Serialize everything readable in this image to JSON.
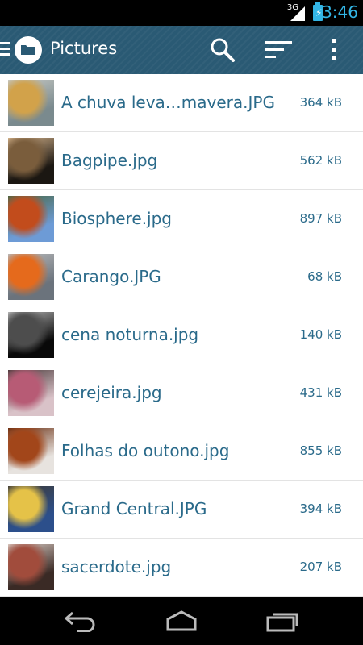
{
  "status_bar": {
    "network": "3G",
    "time": "3:46"
  },
  "action_bar": {
    "title": "Pictures"
  },
  "files": [
    {
      "name": "A chuva leva…mavera.JPG",
      "size": "364 kB",
      "thumb_colors": [
        "#7a8a8e",
        "#d2a24a",
        "#c7c9c4"
      ]
    },
    {
      "name": "Bagpipe.jpg",
      "size": "562 kB",
      "thumb_colors": [
        "#1b1712",
        "#7a5d3c",
        "#d6b48c"
      ]
    },
    {
      "name": "Biosphere.jpg",
      "size": "897 kB",
      "thumb_colors": [
        "#6d9bd6",
        "#c24c1c",
        "#496744"
      ]
    },
    {
      "name": "Carango.JPG",
      "size": "68 kB",
      "thumb_colors": [
        "#6b737c",
        "#e56a1c",
        "#b9babb"
      ]
    },
    {
      "name": "cena noturna.jpg",
      "size": "140 kB",
      "thumb_colors": [
        "#090909",
        "#4d4d4d",
        "#b8b8b8"
      ]
    },
    {
      "name": "cerejeira.jpg",
      "size": "431 kB",
      "thumb_colors": [
        "#d9c2c8",
        "#b75b75",
        "#4b3b3c"
      ]
    },
    {
      "name": "Folhas do outono.jpg",
      "size": "855 kB",
      "thumb_colors": [
        "#e7e3df",
        "#a2461a",
        "#6b2f12"
      ]
    },
    {
      "name": "Grand Central.JPG",
      "size": "394 kB",
      "thumb_colors": [
        "#2c4f8b",
        "#e5c248",
        "#3e3a35"
      ]
    },
    {
      "name": "sacerdote.jpg",
      "size": "207 kB",
      "thumb_colors": [
        "#3a2a25",
        "#a14c3c",
        "#d9cac2"
      ]
    }
  ],
  "colors": {
    "accent": "#33b5e5",
    "action_bar": "#2a5a74",
    "text": "#2a6a8a"
  }
}
